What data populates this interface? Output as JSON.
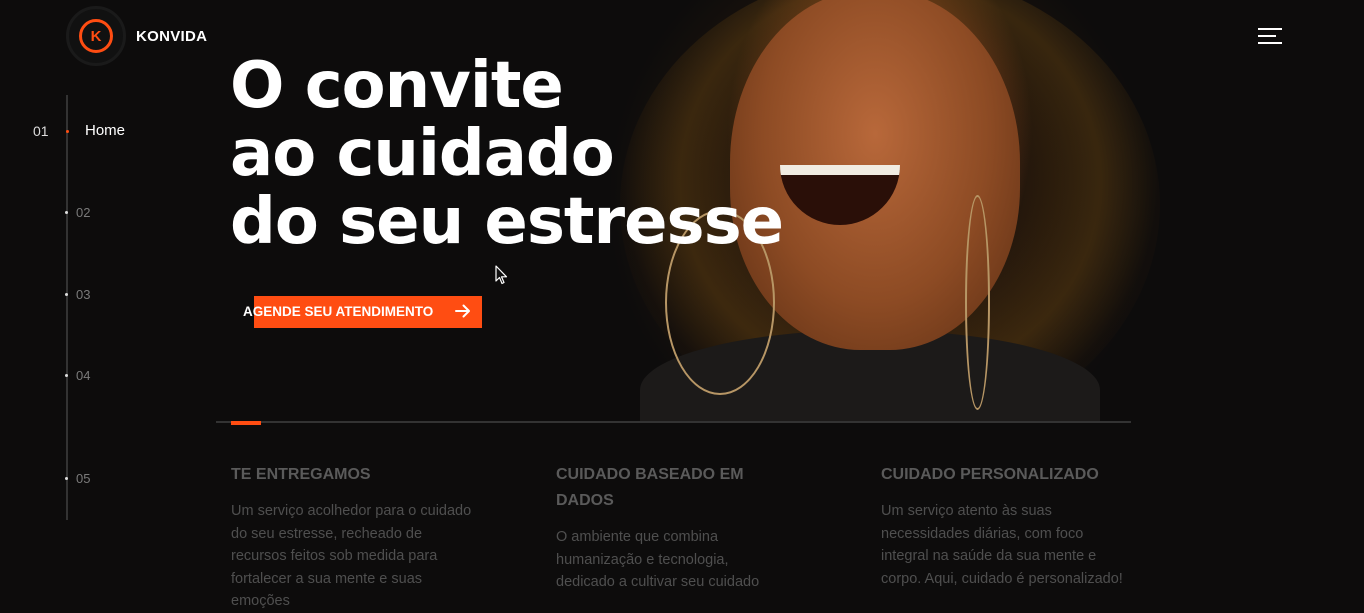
{
  "brand": {
    "name": "KONVIDA",
    "logo_letter": "K",
    "accent_color": "#ff4d12"
  },
  "header": {
    "menu_icon": "hamburger-menu-icon"
  },
  "side_nav": {
    "active": {
      "number": "01",
      "label": "Home"
    },
    "items": [
      "02",
      "03",
      "04",
      "05"
    ]
  },
  "hero": {
    "headline": [
      "O convite",
      "ao cuidado",
      "do seu estresse"
    ],
    "cta_label": "AGENDE SEU ATENDIMENTO",
    "cta_icon": "arrow-right-icon"
  },
  "features": [
    {
      "title": "TE ENTREGAMOS",
      "text": "Um serviço acolhedor para o cuidado do seu estresse, recheado de recursos feitos sob medida para fortalecer a sua mente e suas emoções"
    },
    {
      "title": "CUIDADO BASEADO EM DADOS",
      "text": "O ambiente que combina humanização e tecnologia, dedicado a cultivar seu cuidado"
    },
    {
      "title": "CUIDADO PERSONALIZADO",
      "text": "Um serviço atento às suas necessidades diárias, com foco integral na saúde da sua mente e corpo. Aqui, cuidado é personalizado!"
    }
  ]
}
